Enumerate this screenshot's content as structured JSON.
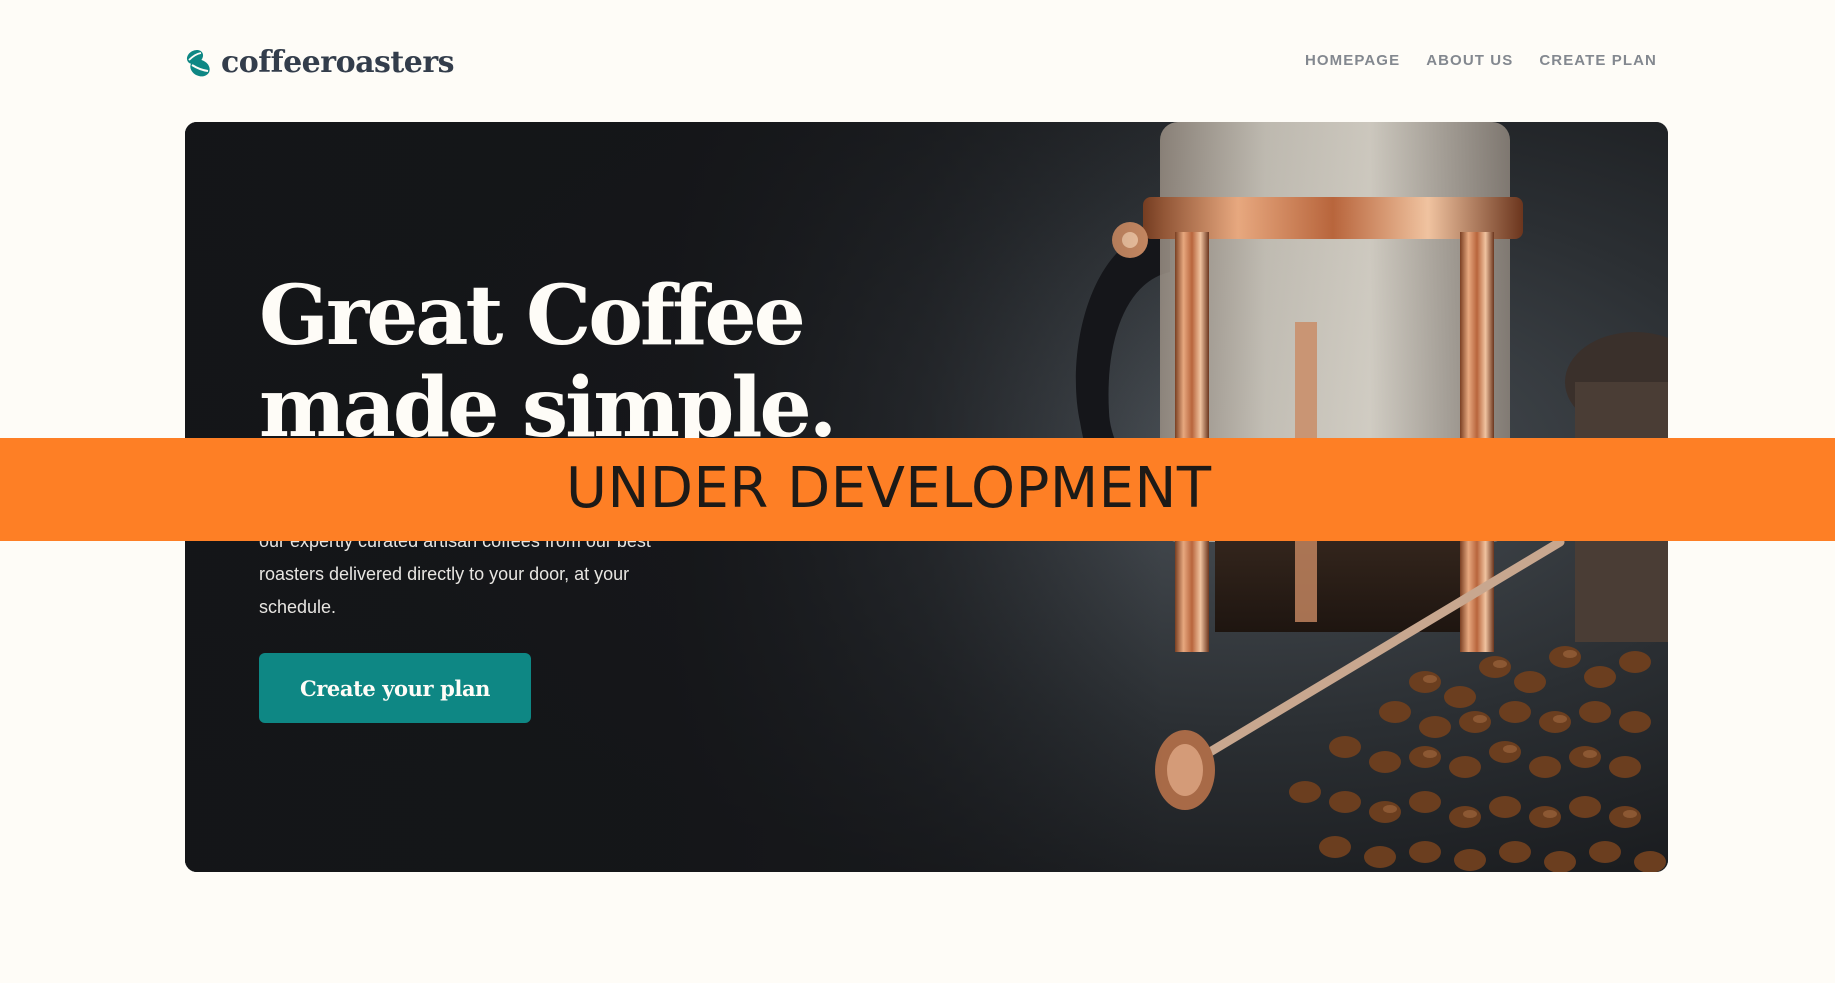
{
  "brand": {
    "name": "coffeeroasters",
    "accent_color": "#0E8784",
    "background_color": "#FEFCF7",
    "logo_icon": "coffee-bean-icon"
  },
  "nav": {
    "items": [
      {
        "label": "HOMEPAGE"
      },
      {
        "label": "ABOUT US"
      },
      {
        "label": "CREATE PLAN"
      }
    ]
  },
  "hero": {
    "title": "Great Coffee made simple.",
    "text": "Start your mornings with the world’s best coffees. Try our expertly curated artisan coffees from our best roasters delivered directly to your door, at your schedule.",
    "cta_label": "Create your plan",
    "image": "french-press-and-coffee-beans-photo"
  },
  "banner": {
    "label": "UNDER DEVELOPMENT",
    "color": "#FE7F25"
  }
}
